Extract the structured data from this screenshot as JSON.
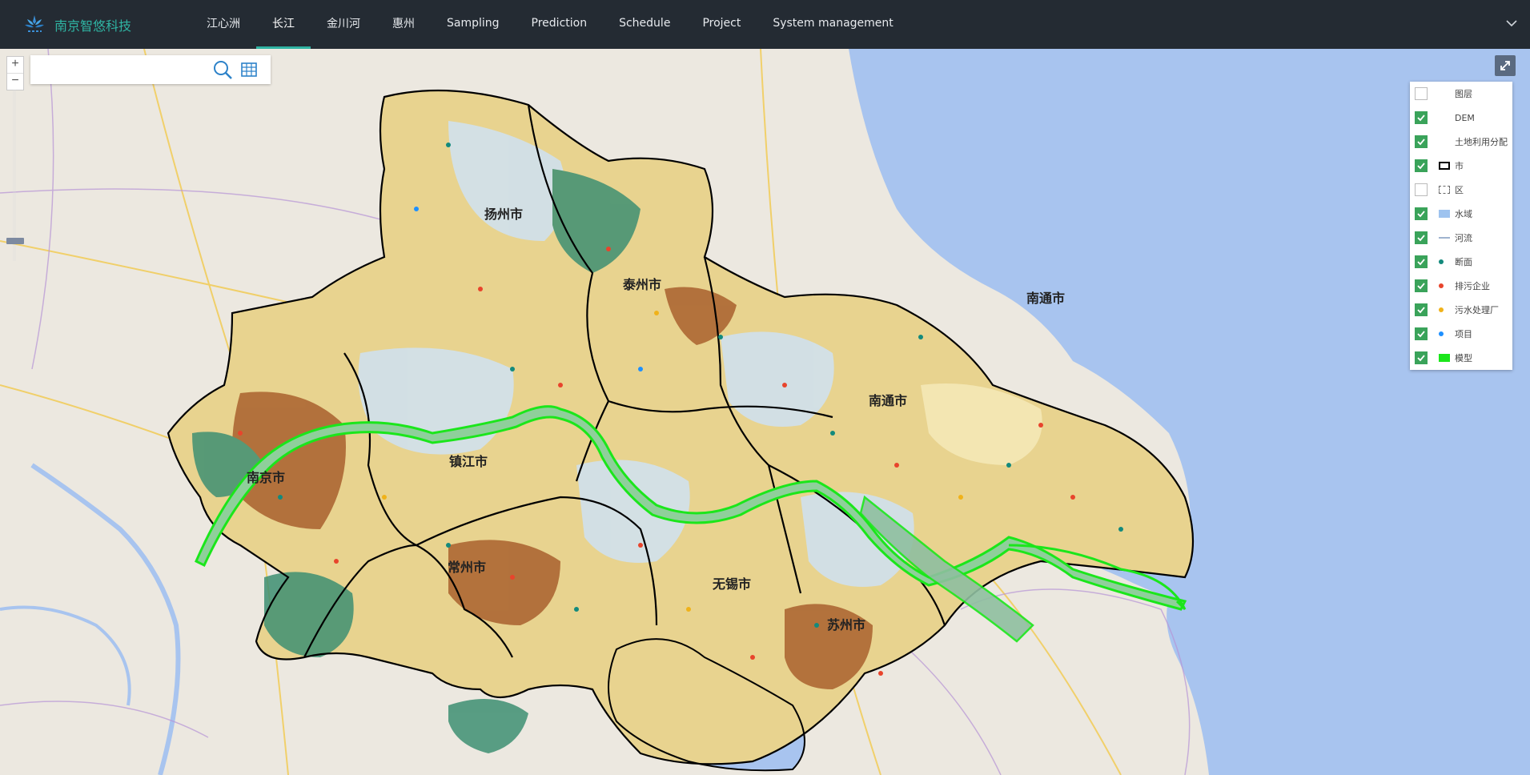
{
  "brand": {
    "name": "南京智悠科技",
    "logo_icon": "lotus-logo-icon"
  },
  "nav": [
    {
      "label": "江心洲",
      "active": false
    },
    {
      "label": "长江",
      "active": true
    },
    {
      "label": "金川河",
      "active": false
    },
    {
      "label": "惠州",
      "active": false
    },
    {
      "label": "Sampling",
      "active": false
    },
    {
      "label": "Prediction",
      "active": false
    },
    {
      "label": "Schedule",
      "active": false
    },
    {
      "label": "Project",
      "active": false
    },
    {
      "label": "System management",
      "active": false
    }
  ],
  "colors": {
    "topbar": "#242b33",
    "accent": "#2fb3a2",
    "river_model": "#39e639",
    "checkbox": "#3aa35a"
  },
  "map_controls": {
    "zoom_in": "+",
    "zoom_out": "−"
  },
  "search": {
    "value": "",
    "placeholder": ""
  },
  "layers": [
    {
      "label": "图层",
      "checked": false,
      "symbol": "none"
    },
    {
      "label": "DEM",
      "checked": true,
      "symbol": "none"
    },
    {
      "label": "土地利用分配",
      "checked": true,
      "symbol": "none"
    },
    {
      "label": "市",
      "checked": true,
      "symbol": "solid-box",
      "color": "#000000"
    },
    {
      "label": "区",
      "checked": false,
      "symbol": "dashed-box",
      "color": "#666666"
    },
    {
      "label": "水域",
      "checked": true,
      "symbol": "fill",
      "color": "#9ec3ef"
    },
    {
      "label": "河流",
      "checked": true,
      "symbol": "line",
      "color": "#9fb3cf"
    },
    {
      "label": "断面",
      "checked": true,
      "symbol": "dot",
      "color": "#138a7c"
    },
    {
      "label": "排污企业",
      "checked": true,
      "symbol": "dot",
      "color": "#e8442c"
    },
    {
      "label": "污水处理厂",
      "checked": true,
      "symbol": "dot",
      "color": "#f0b21a"
    },
    {
      "label": "项目",
      "checked": true,
      "symbol": "dot",
      "color": "#1e90ff"
    },
    {
      "label": "模型",
      "checked": true,
      "symbol": "fill",
      "color": "#1be61b"
    }
  ],
  "city_labels": [
    {
      "name": "扬州市"
    },
    {
      "name": "泰州市"
    },
    {
      "name": "南通市"
    },
    {
      "name": "南通市"
    },
    {
      "name": "镇江市"
    },
    {
      "name": "南京市"
    },
    {
      "name": "常州市"
    },
    {
      "name": "无锡市"
    },
    {
      "name": "苏州市"
    }
  ]
}
